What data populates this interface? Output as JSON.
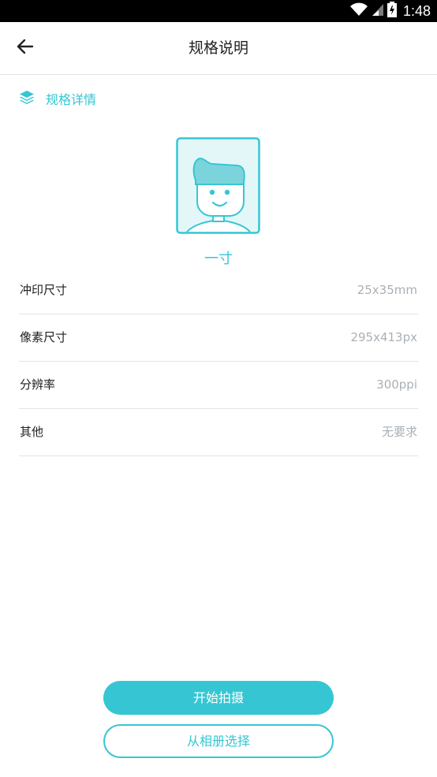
{
  "status_bar": {
    "time": "1:48",
    "icons": [
      "wifi-icon",
      "signal-icon",
      "battery-icon"
    ]
  },
  "header": {
    "back_icon": "arrow-left-icon",
    "title": "规格说明"
  },
  "section": {
    "icon": "layers-icon",
    "title": "规格详情"
  },
  "photo": {
    "illustration": "portrait-avatar-icon",
    "size_name": "一寸"
  },
  "specs": [
    {
      "label": "冲印尺寸",
      "value": "25x35mm"
    },
    {
      "label": "像素尺寸",
      "value": "295x413px"
    },
    {
      "label": "分辨率",
      "value": "300ppi"
    },
    {
      "label": "其他",
      "value": "无要求"
    }
  ],
  "actions": {
    "primary_label": "开始拍摄",
    "secondary_label": "从相册选择"
  },
  "colors": {
    "accent": "#36c6d3",
    "accent_light": "#e3f7f9",
    "text_primary": "#222222",
    "text_secondary": "#aab0b5",
    "divider": "#e3e3e3",
    "status_bar": "#000000"
  }
}
